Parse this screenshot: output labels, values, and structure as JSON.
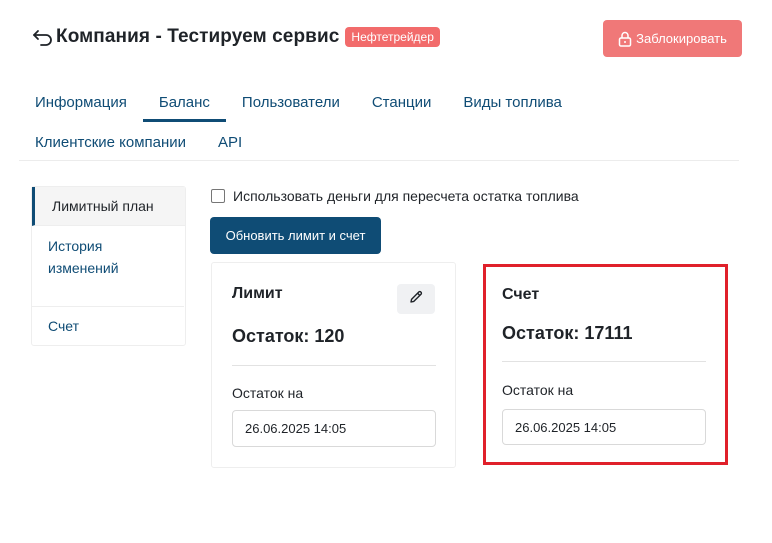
{
  "header": {
    "title": "Компания - Тестируем сервис",
    "badge": "Нефтетрейдер",
    "block_label": "Заблокировать"
  },
  "tabs": {
    "row1": [
      "Информация",
      "Баланс",
      "Пользователи",
      "Станции",
      "Виды топлива"
    ],
    "row2": [
      "Клиентские компании",
      "API"
    ],
    "active": "Баланс"
  },
  "sidebar": {
    "items": [
      {
        "label": "Лимитный план",
        "active": true
      },
      {
        "label": "История изменений",
        "active": false
      },
      {
        "label": "Счет",
        "active": false
      }
    ]
  },
  "options": {
    "use_money_label": "Использовать деньги для пересчета остатка топлива",
    "use_money_checked": false
  },
  "update_button": "Обновить лимит и счет",
  "limit_card": {
    "title": "Лимит",
    "balance": "Остаток: 120",
    "date_label": "Остаток на",
    "date_value": "26.06.2025 14:05"
  },
  "account_card": {
    "title": "Счет",
    "balance": "Остаток: 17111",
    "date_label": "Остаток на",
    "date_value": "26.06.2025 14:05"
  },
  "colors": {
    "primary": "#0f4c75",
    "danger_button": "#f07878",
    "badge": "#f26b6b",
    "highlight": "#e0202a"
  },
  "icons": {
    "back": "back-arrow-icon",
    "lock": "lock-icon",
    "edit": "pencil-icon"
  }
}
